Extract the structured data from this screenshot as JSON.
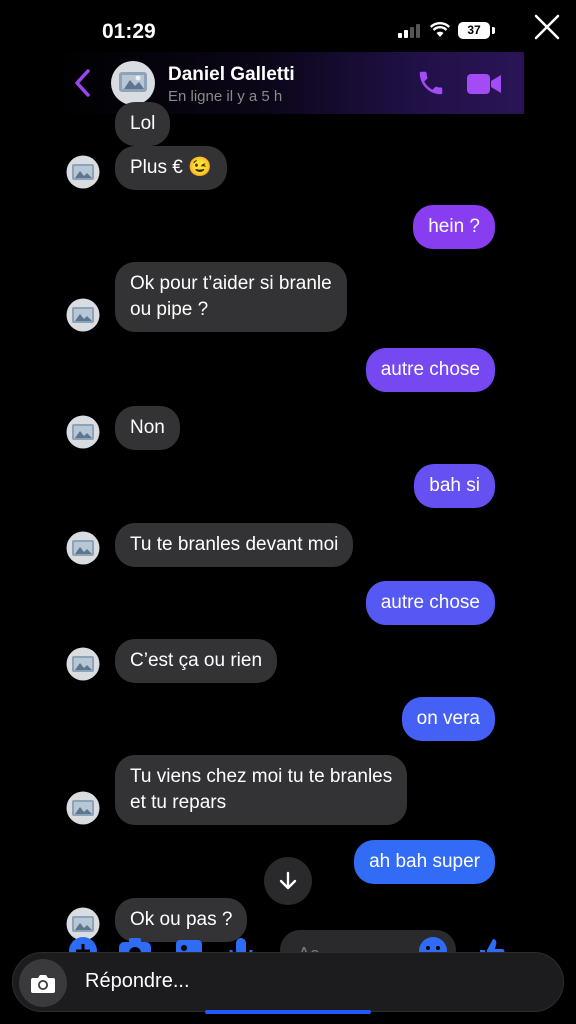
{
  "status": {
    "time": "01:29",
    "battery": "37"
  },
  "header": {
    "name": "Daniel Galletti",
    "presence": "En ligne il y a 5 h"
  },
  "messages": [
    {
      "dir": "in",
      "text": "Lol"
    },
    {
      "dir": "in",
      "text": "Plus € 😉"
    },
    {
      "dir": "out",
      "text": "hein ?"
    },
    {
      "dir": "in",
      "text": "Ok pour t’aider si branle\nou pipe ?"
    },
    {
      "dir": "out",
      "text": "autre chose"
    },
    {
      "dir": "in",
      "text": "Non"
    },
    {
      "dir": "out",
      "text": "bah si"
    },
    {
      "dir": "in",
      "text": "Tu te branles devant moi"
    },
    {
      "dir": "out",
      "text": "autre chose"
    },
    {
      "dir": "in",
      "text": "C’est ça ou rien"
    },
    {
      "dir": "out",
      "text": "on vera"
    },
    {
      "dir": "in",
      "text": "Tu viens chez moi tu te branles\net tu repars"
    },
    {
      "dir": "out",
      "text": "ah bah super"
    },
    {
      "dir": "in",
      "text": "Ok ou pas ?"
    }
  ],
  "composer": {
    "placeholder": "Aa"
  },
  "reply": {
    "placeholder": "Répondre..."
  },
  "colors": {
    "outgoing_top": "#8a3df0",
    "outgoing_bottom": "#2e6cf6",
    "incoming": "#333335",
    "accent": "#a34bf5"
  },
  "icons": [
    "close-icon",
    "back-icon",
    "phone-icon",
    "video-icon",
    "chevron-down-icon",
    "plus-icon",
    "camera-icon",
    "gallery-icon",
    "mic-icon",
    "emoji-icon",
    "thumbs-up-icon"
  ]
}
